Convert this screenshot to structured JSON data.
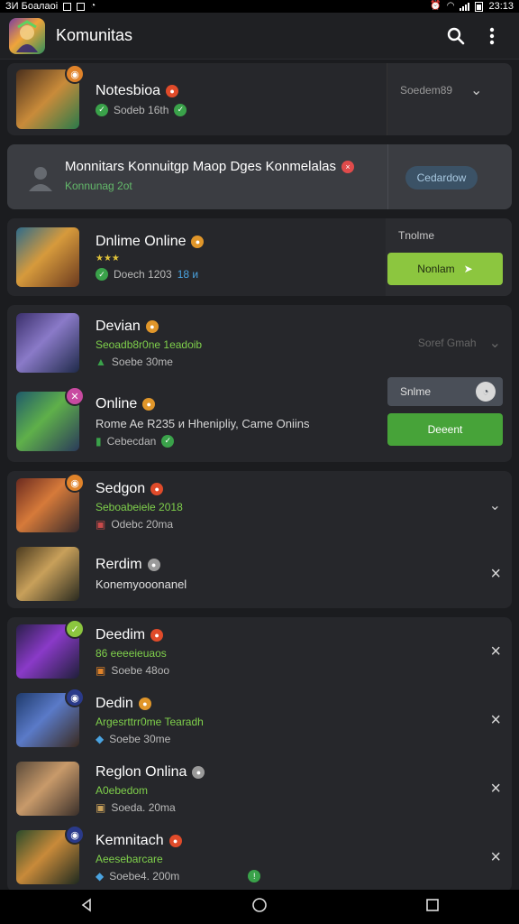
{
  "status_bar": {
    "left_text": "ЗИ Боалаоі",
    "time": "23:13"
  },
  "app_bar": {
    "title": "Komunitas"
  },
  "items": [
    {
      "name": "Notesbioa",
      "meta": "Sodeb 16th",
      "dropdown": "Soedem89"
    },
    {
      "title": "Monnitars Konnuitgp Maop Dges Konmelalas",
      "subtitle": "Konnunag 2ot",
      "button": "Cedardow"
    },
    {
      "name": "Dnlime Online",
      "sub": "★★★",
      "meta": "Doech 1203",
      "meta_highlight": "18 ᴎ",
      "tab_label": "Tnolme",
      "button": "Nonlam"
    },
    {
      "name": "Devian",
      "sub": "Seoadb8r0ne 1eadoib",
      "meta": "Soebe 30me",
      "dropdown": "Soref Gmah"
    },
    {
      "name": "Online",
      "desc": "Rome Ae R235 ᴎ Hhenipliy, Came Oniins",
      "meta": "Cebecdan",
      "button_gray": "Snlme",
      "button_green": "Deeent"
    },
    {
      "name": "Sedgon",
      "sub": "Seboabeiele 2018",
      "meta": "Odebc 20ma"
    },
    {
      "name": "Rerdim",
      "sub": "Konemyooonanel"
    },
    {
      "name": "Deedim",
      "sub": "86 eeeeieuaos",
      "meta": "Soebe 48oo"
    },
    {
      "name": "Dedin",
      "sub": "Argesrttrr0me Tearadh",
      "meta": "Soebe 30me"
    },
    {
      "name": "Reglon Onlina",
      "sub": "A0ebedom",
      "meta": "Soeda. 20ma"
    },
    {
      "name": "Kemnitach",
      "sub": "Aeesebarcare",
      "meta": "Soebe4. 200m"
    }
  ],
  "colors": {
    "accent_green": "#8cc63f",
    "button_green": "#47a339",
    "background": "#1b1c1f",
    "card": "#26272b"
  },
  "icons": [
    "search-icon",
    "more-vert-icon",
    "chevron-down-icon",
    "close-icon",
    "back-icon",
    "home-icon",
    "recents-icon"
  ]
}
